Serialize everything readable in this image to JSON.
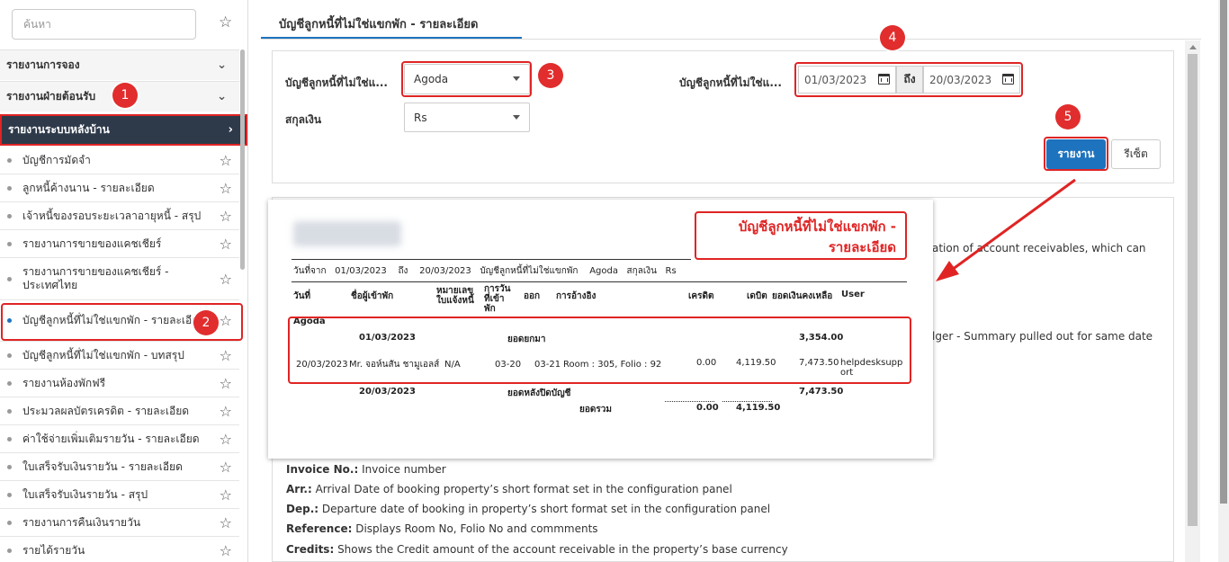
{
  "sidebar": {
    "search_placeholder": "ค้นหา",
    "sections": [
      {
        "label": "รายงานการจอง"
      },
      {
        "label": "รายงานฝ่ายต้อนรับ"
      },
      {
        "label": "รายงานระบบหลังบ้าน"
      }
    ],
    "items": [
      {
        "label": "บัญชีการมัดจำ"
      },
      {
        "label": "ลูกหนี้ค้างนาน - รายละเอียด"
      },
      {
        "label": "เจ้าหนี้ของรอบระยะเวลาอายุหนี้ - สรุป"
      },
      {
        "label": "รายงานการขายของแคชเชียร์"
      },
      {
        "label": "รายงานการขายของแคชเชียร์ - ประเทศไทย"
      },
      {
        "label": "บัญชีลูกหนี้ที่ไม่ใช่แขกพัก - รายละเอียด"
      },
      {
        "label": "บัญชีลูกหนี้ที่ไม่ใช่แขกพัก - บทสรุป"
      },
      {
        "label": "รายงานห้องพักฟรี"
      },
      {
        "label": "ประมวลผลบัตรเครดิต - รายละเอียด"
      },
      {
        "label": "ค่าใช้จ่ายเพิ่มเติมรายวัน - รายละเอียด"
      },
      {
        "label": "ใบเสร็จรับเงินรายวัน - รายละเอียด"
      },
      {
        "label": "ใบเสร็จรับเงินรายวัน - สรุป"
      },
      {
        "label": "รายงานการคืนเงินรายวัน"
      },
      {
        "label": "รายได้รายวัน"
      }
    ]
  },
  "callouts": [
    "1",
    "2",
    "3",
    "4",
    "5"
  ],
  "main": {
    "tab_title": "บัญชีลูกหนี้ที่ไม่ใช่แขกพัก - รายละเอียด",
    "filters": {
      "account_label": "บัญชีลูกหนี้ที่ไม่ใช่แ...",
      "account_value": "Agoda",
      "currency_label": "สกุลเงิน",
      "currency_value": "Rs",
      "date_label": "บัญชีลูกหนี้ที่ไม่ใช่แ...",
      "date_from": "01/03/2023",
      "date_to_label": "ถึง",
      "date_to": "20/03/2023"
    },
    "buttons": {
      "report": "รายงาน",
      "reset": "รีเซ็ต"
    },
    "doc_fragments": {
      "line1_tail": "ation of account receivables, which can",
      "line2_tail": "lger - Summary pulled out for same date"
    },
    "definitions": [
      {
        "term": "Invoice No.:",
        "desc": " Invoice number"
      },
      {
        "term": "Arr.:",
        "desc": " Arrival Date of booking property’s short format set in the configuration panel"
      },
      {
        "term": "Dep.:",
        "desc": " Departure date of booking in property’s short format set in the configuration panel"
      },
      {
        "term": "Reference:",
        "desc": " Displays Room No, Folio No and commments"
      },
      {
        "term": "Credits:",
        "desc": " Shows the Credit amount of the account receivable in the property’s base currency"
      }
    ]
  },
  "report_preview": {
    "title": "บัญชีลูกหนี้ที่ไม่ใช่แขกพัก - รายละเอียด",
    "title_line1": "บัญชีลูกหนี้ที่ไม่ใช่แขกพัก -",
    "title_line2": "รายละเอียด",
    "filter_line": {
      "from_label": "วันที่จาก",
      "from": "01/03/2023",
      "to_label": "ถึง",
      "to": "20/03/2023",
      "account_label": "บัญชีลูกหนี้ที่ไม่ใช่แขกพัก",
      "account": "Agoda",
      "currency_label": "สกุลเงิน",
      "currency": "Rs"
    },
    "columns": [
      "วันที่",
      "ชื่อผู้เข้าพัก",
      "หมายเลข ใบแจ้งหนี้",
      "การวัน ที่เข้า พัก",
      "ออก",
      "การอ้างอิง",
      "เครดิต",
      "เดบิต",
      "ยอดเงินคงเหลือ",
      "User"
    ],
    "col_invoice_1": "หมายเลข",
    "col_invoice_2": "ใบแจ้งหนี้",
    "col_arr_1": "การวัน",
    "col_arr_2": "ที่เข้า",
    "col_arr_3": "พัก",
    "col_debit": "เดบิต",
    "col_balance": "ยอดเงินคงเหลือ",
    "group": "Agoda",
    "opening": {
      "date": "01/03/2023",
      "label": "ยอดยกมา",
      "balance": "3,354.00"
    },
    "row": {
      "date": "20/03/2023",
      "guest": "Mr. จอห์นสัน ชามูเอลส์",
      "invoice": "N/A",
      "arr": "03-20",
      "dep": "03-21",
      "reference": "Room : 305, Folio : 92",
      "credit": "0.00",
      "debit": "4,119.50",
      "balance": "7,473.50",
      "user_1": "helpdesksupp",
      "user_2": "ort"
    },
    "closing": {
      "date": "20/03/2023",
      "label": "ยอดหลังปิดบัญชี",
      "balance": "7,473.50"
    },
    "total": {
      "label": "ยอดรวม",
      "credit": "0.00",
      "debit": "4,119.50"
    }
  },
  "colors": {
    "accent": "#1e73be",
    "annotation_red": "#e02424",
    "sidebar_active": "#2e3a4a"
  },
  "icons": [
    "star-icon",
    "chevron-down-icon",
    "chevron-right-icon",
    "calendar-icon",
    "caret-down-icon"
  ]
}
